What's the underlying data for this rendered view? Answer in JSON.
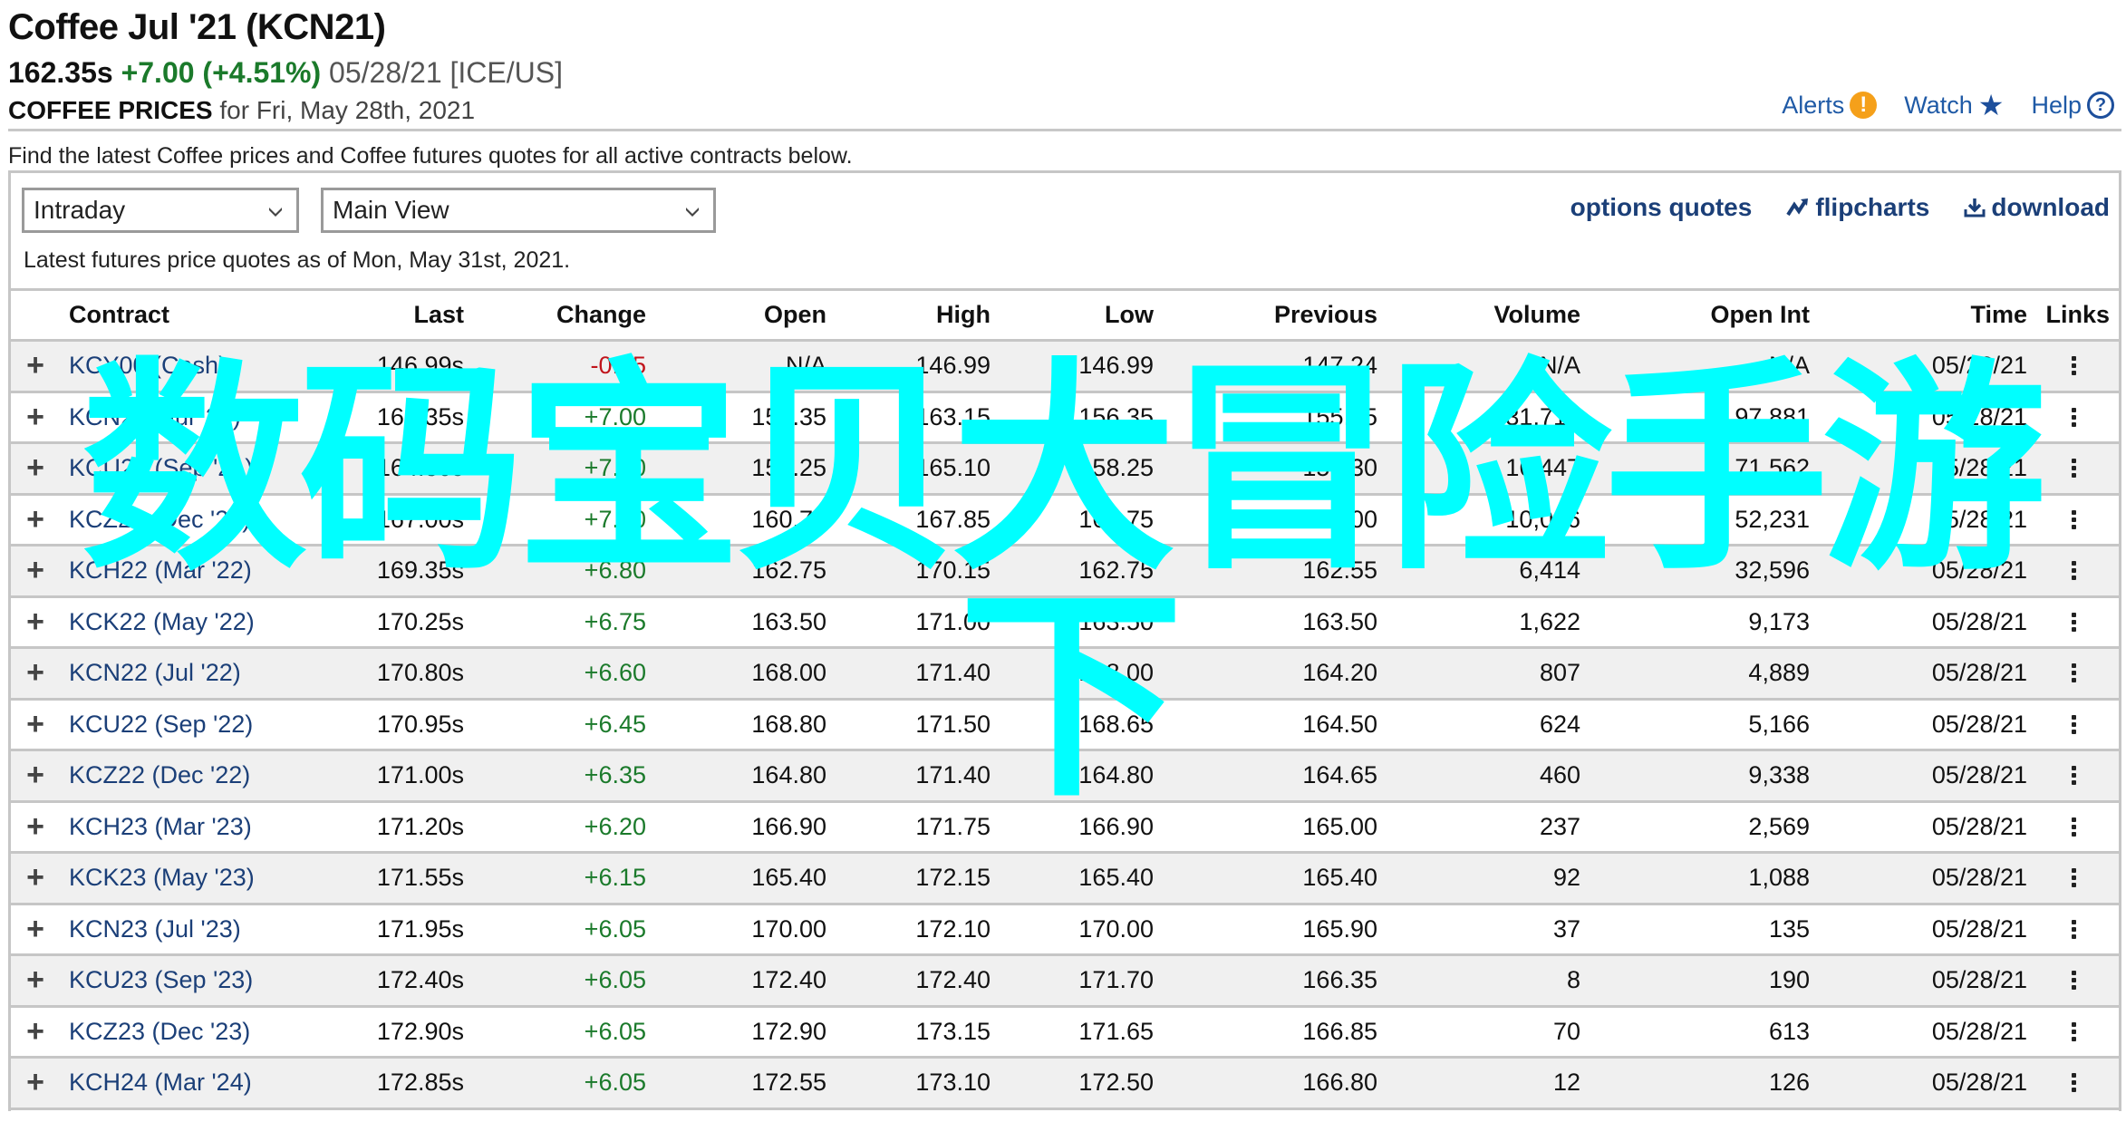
{
  "header": {
    "title": "Coffee Jul '21 (KCN21)",
    "last_price": "162.35s",
    "change": "+7.00 (+4.51%)",
    "date_exchange": "05/28/21 [ICE/US]",
    "prices_label": "COFFEE PRICES",
    "prices_date": "for Fri, May 28th, 2021",
    "links": {
      "alerts": "Alerts",
      "watch": "Watch",
      "help": "Help"
    }
  },
  "intro_text": "Find the latest Coffee prices and Coffee futures quotes for all active contracts below.",
  "controls": {
    "period_select": "Intraday",
    "view_select": "Main View",
    "options_quotes": "options quotes",
    "flipcharts": "flipcharts",
    "download": "download"
  },
  "as_of_text": "Latest futures price quotes as of Mon, May 31st, 2021.",
  "table": {
    "columns": [
      "Contract",
      "Last",
      "Change",
      "Open",
      "High",
      "Low",
      "Previous",
      "Volume",
      "Open Int",
      "Time",
      "Links"
    ],
    "rows": [
      {
        "contract": "KCY00 (Cash)",
        "last": "146.99s",
        "change": "-0.25",
        "dir": "neg",
        "open": "N/A",
        "high": "146.99",
        "low": "146.99",
        "previous": "147.24",
        "volume": "N/A",
        "open_int": "N/A",
        "time": "05/28/21"
      },
      {
        "contract": "KCN21 (Jul '21)",
        "last": "162.35s",
        "change": "+7.00",
        "dir": "pos",
        "open": "156.35",
        "high": "163.15",
        "low": "156.35",
        "previous": "155.35",
        "volume": "31,712",
        "open_int": "97,881",
        "time": "05/28/21"
      },
      {
        "contract": "KCU21 (Sep '21)",
        "last": "164.30s",
        "change": "+7.00",
        "dir": "pos",
        "open": "158.25",
        "high": "165.10",
        "low": "158.25",
        "previous": "157.30",
        "volume": "16,447",
        "open_int": "71,562",
        "time": "05/28/21"
      },
      {
        "contract": "KCZ21 (Dec '21)",
        "last": "167.00s",
        "change": "+7.00",
        "dir": "pos",
        "open": "160.75",
        "high": "167.85",
        "low": "160.75",
        "previous": "160.00",
        "volume": "10,016",
        "open_int": "52,231",
        "time": "05/28/21"
      },
      {
        "contract": "KCH22 (Mar '22)",
        "last": "169.35s",
        "change": "+6.80",
        "dir": "pos",
        "open": "162.75",
        "high": "170.15",
        "low": "162.75",
        "previous": "162.55",
        "volume": "6,414",
        "open_int": "32,596",
        "time": "05/28/21"
      },
      {
        "contract": "KCK22 (May '22)",
        "last": "170.25s",
        "change": "+6.75",
        "dir": "pos",
        "open": "163.50",
        "high": "171.00",
        "low": "163.50",
        "previous": "163.50",
        "volume": "1,622",
        "open_int": "9,173",
        "time": "05/28/21"
      },
      {
        "contract": "KCN22 (Jul '22)",
        "last": "170.80s",
        "change": "+6.60",
        "dir": "pos",
        "open": "168.00",
        "high": "171.40",
        "low": "168.00",
        "previous": "164.20",
        "volume": "807",
        "open_int": "4,889",
        "time": "05/28/21"
      },
      {
        "contract": "KCU22 (Sep '22)",
        "last": "170.95s",
        "change": "+6.45",
        "dir": "pos",
        "open": "168.80",
        "high": "171.50",
        "low": "168.65",
        "previous": "164.50",
        "volume": "624",
        "open_int": "5,166",
        "time": "05/28/21"
      },
      {
        "contract": "KCZ22 (Dec '22)",
        "last": "171.00s",
        "change": "+6.35",
        "dir": "pos",
        "open": "164.80",
        "high": "171.40",
        "low": "164.80",
        "previous": "164.65",
        "volume": "460",
        "open_int": "9,338",
        "time": "05/28/21"
      },
      {
        "contract": "KCH23 (Mar '23)",
        "last": "171.20s",
        "change": "+6.20",
        "dir": "pos",
        "open": "166.90",
        "high": "171.75",
        "low": "166.90",
        "previous": "165.00",
        "volume": "237",
        "open_int": "2,569",
        "time": "05/28/21"
      },
      {
        "contract": "KCK23 (May '23)",
        "last": "171.55s",
        "change": "+6.15",
        "dir": "pos",
        "open": "165.40",
        "high": "172.15",
        "low": "165.40",
        "previous": "165.40",
        "volume": "92",
        "open_int": "1,088",
        "time": "05/28/21"
      },
      {
        "contract": "KCN23 (Jul '23)",
        "last": "171.95s",
        "change": "+6.05",
        "dir": "pos",
        "open": "170.00",
        "high": "172.10",
        "low": "170.00",
        "previous": "165.90",
        "volume": "37",
        "open_int": "135",
        "time": "05/28/21"
      },
      {
        "contract": "KCU23 (Sep '23)",
        "last": "172.40s",
        "change": "+6.05",
        "dir": "pos",
        "open": "172.40",
        "high": "172.40",
        "low": "171.70",
        "previous": "166.35",
        "volume": "8",
        "open_int": "190",
        "time": "05/28/21"
      },
      {
        "contract": "KCZ23 (Dec '23)",
        "last": "172.90s",
        "change": "+6.05",
        "dir": "pos",
        "open": "172.90",
        "high": "173.15",
        "low": "171.65",
        "previous": "166.85",
        "volume": "70",
        "open_int": "613",
        "time": "05/28/21"
      },
      {
        "contract": "KCH24 (Mar '24)",
        "last": "172.85s",
        "change": "+6.05",
        "dir": "pos",
        "open": "172.55",
        "high": "173.10",
        "low": "172.50",
        "previous": "166.80",
        "volume": "12",
        "open_int": "126",
        "time": "05/28/21"
      }
    ]
  },
  "colors": {
    "positive": "#1b7a2b",
    "negative": "#c0141b",
    "link": "#1b3f78",
    "alert": "#f5a01a",
    "watermark": "#00ffff"
  },
  "watermark": {
    "line1": "数码宝贝大冒险手游",
    "line2": "下"
  }
}
